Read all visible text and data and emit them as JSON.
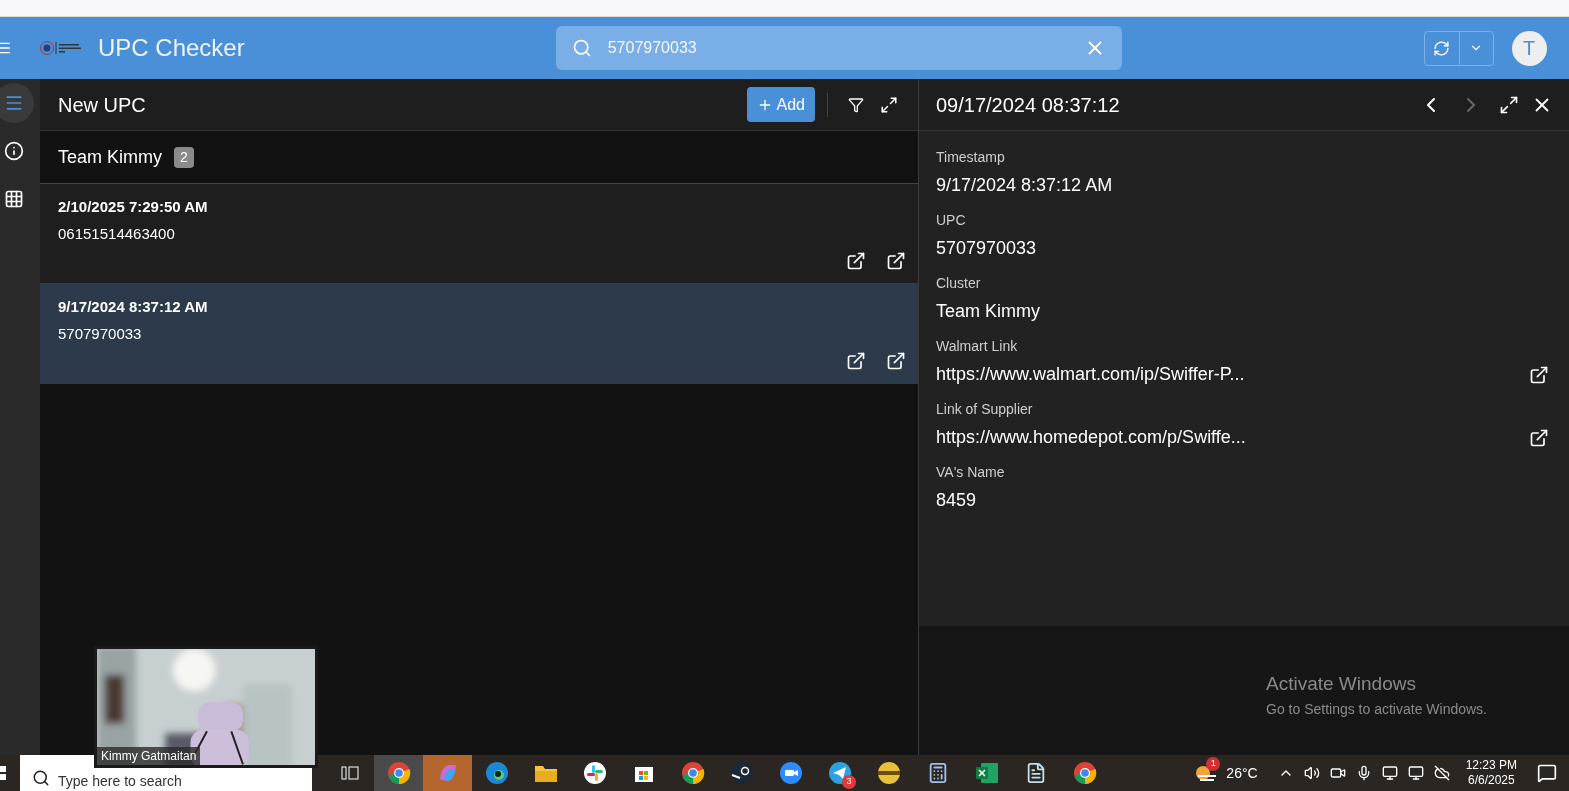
{
  "header": {
    "title": "UPC Checker",
    "search": {
      "value": "5707970033"
    },
    "avatar": "T"
  },
  "sidebar": {
    "items": [
      {
        "kind": "list",
        "selected": true
      },
      {
        "kind": "info",
        "selected": false
      },
      {
        "kind": "apps",
        "selected": false
      }
    ]
  },
  "list_panel": {
    "title": "New UPC",
    "add_button": "Add",
    "group": {
      "name": "Team Kimmy",
      "count": "2"
    },
    "rows": [
      {
        "timestamp": "2/10/2025 7:29:50 AM",
        "upc": "06151514463400",
        "selected": false
      },
      {
        "timestamp": "9/17/2024 8:37:12 AM",
        "upc": "5707970033",
        "selected": true
      }
    ]
  },
  "detail_panel": {
    "title": "09/17/2024 08:37:12",
    "prev_disabled": false,
    "next_disabled": true,
    "fields": [
      {
        "label": "Timestamp",
        "value": "9/17/2024 8:37:12 AM",
        "kind": "text"
      },
      {
        "label": "UPC",
        "value": "5707970033",
        "kind": "text"
      },
      {
        "label": "Cluster",
        "value": "Team Kimmy",
        "kind": "text"
      },
      {
        "label": "Walmart Link",
        "value": "https://www.walmart.com/ip/Swiffer-P...",
        "kind": "link"
      },
      {
        "label": "Link of Supplier",
        "value": "https://www.homedepot.com/p/Swiffe...",
        "kind": "link"
      },
      {
        "label": "VA's Name",
        "value": "8459",
        "kind": "text"
      }
    ]
  },
  "activation_notice": {
    "title": "Activate Windows",
    "text": "Go to Settings to activate Windows."
  },
  "video_overlay": {
    "kind": "picture",
    "name": "Kimmy Gatmaitan"
  },
  "taskbar": {
    "search_placeholder": "Type here to search",
    "apps": [
      {
        "kind": "taskview",
        "active": false
      },
      {
        "kind": "chrome",
        "active": true
      },
      {
        "kind": "copilot",
        "active": true
      },
      {
        "kind": "edge",
        "active": false
      },
      {
        "kind": "folder",
        "active": false
      },
      {
        "kind": "slack",
        "active": false
      },
      {
        "kind": "store",
        "active": false
      },
      {
        "kind": "chrome",
        "active": false
      },
      {
        "kind": "steam",
        "active": false
      },
      {
        "kind": "zoom",
        "active": false
      },
      {
        "kind": "telegram",
        "active": false,
        "badge": "3"
      },
      {
        "kind": "bowl",
        "active": false
      },
      {
        "kind": "calculator",
        "active": false
      },
      {
        "kind": "excel",
        "active": false
      },
      {
        "kind": "notepad",
        "active": false
      },
      {
        "kind": "chrome",
        "active": false
      }
    ],
    "weather_badge": "1",
    "temperature": "26°C",
    "time": "12:23 PM",
    "date": "6/6/2025"
  }
}
